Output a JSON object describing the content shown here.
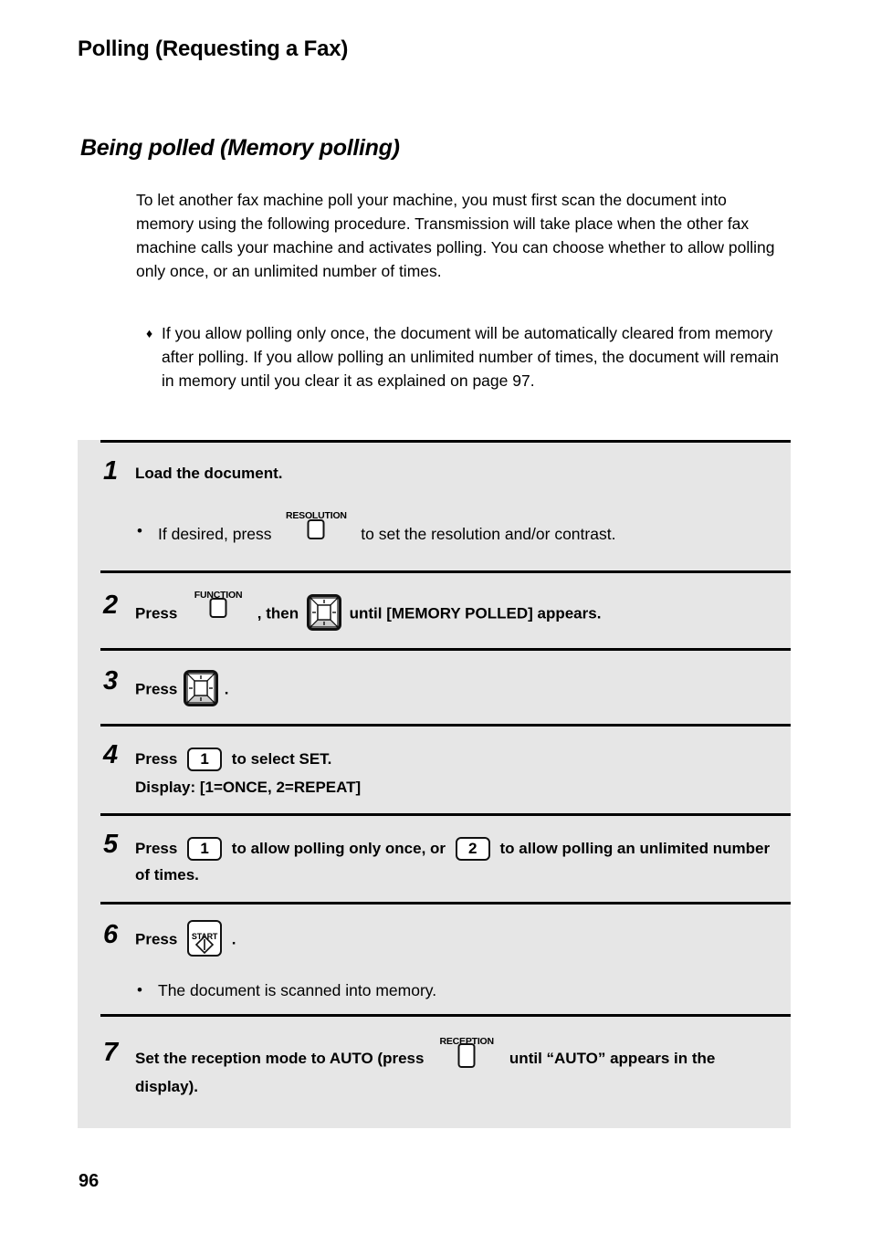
{
  "page": {
    "title": "Polling (Requesting a Fax)",
    "section_title": "Being polled (Memory polling)",
    "folio": "96",
    "panel_bg": "#e6e6e6",
    "text_color": "#000000"
  },
  "intro": {
    "paragraph": "To let another fax machine poll your machine, you must first scan the document into memory using the following procedure. Transmission will take place when the other fax machine calls your machine and activates polling. You can choose whether to allow polling only once, or an unlimited number of times.",
    "bullet_marker": "♦",
    "bullet": "If you allow polling only once, the document will be automatically cleared from memory after polling. If you allow polling an unlimited number of times, the document will remain in memory until you clear it as explained on page 97."
  },
  "steps": [
    {
      "number": "1",
      "heading": "Load the document.",
      "sub_marker": "•",
      "sub_pre": "If desired, press",
      "key_label": "RESOLUTION",
      "sub_post": "to set the resolution and/or contrast."
    },
    {
      "number": "2",
      "text_pre": "Press",
      "key_label": "FUNCTION",
      "text_mid": ", then",
      "nav_key": "arrow-key",
      "text_post": "until [MEMORY POLLED] appears."
    },
    {
      "number": "3",
      "text_pre": "Press",
      "nav_key": "arrow-key",
      "text_post": "."
    },
    {
      "number": "4",
      "text_pre": "Press",
      "key": "1",
      "text_post": "to select SET.",
      "line2": "Display: [1=ONCE, 2=REPEAT]"
    },
    {
      "number": "5",
      "text_pre": "Press",
      "key_a": "1",
      "text_mid": "to allow polling only once, or",
      "key_b": "2",
      "text_post": "to allow polling an unlimited number of times."
    },
    {
      "number": "6",
      "text_pre": "Press",
      "start_key_label": "START",
      "text_post": ".",
      "sub_marker": "•",
      "sub": "The document is scanned into memory."
    },
    {
      "number": "7",
      "text_pre": "Set the reception mode to AUTO (press",
      "key_label": "RECEPTION",
      "text_post": "until “AUTO” appears in the display)."
    }
  ]
}
